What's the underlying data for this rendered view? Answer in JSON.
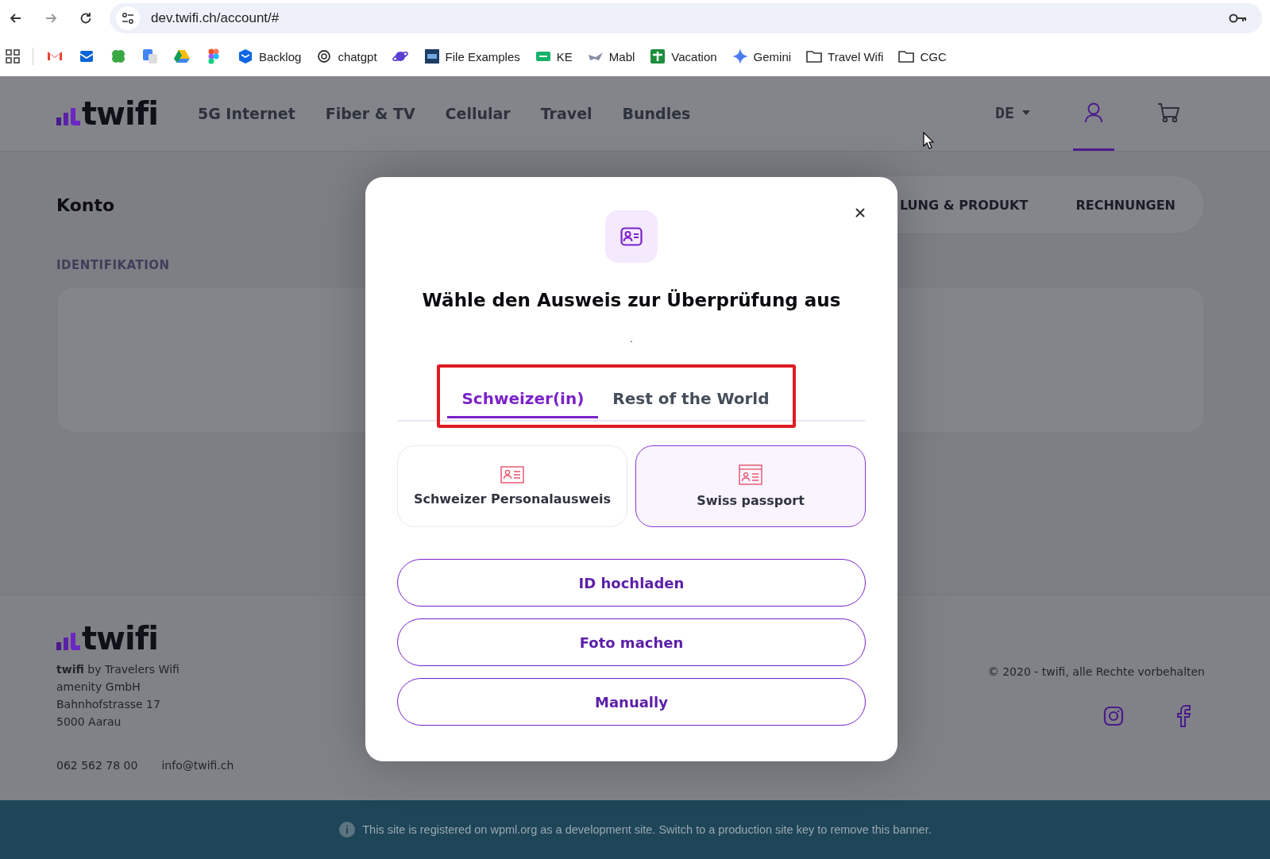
{
  "browser": {
    "url": "dev.twifi.ch/account/#",
    "bookmarks": [
      {
        "kind": "icon_only"
      },
      {
        "kind": "icon_only"
      },
      {
        "kind": "icon_only"
      },
      {
        "kind": "icon_only"
      },
      {
        "kind": "icon_only"
      },
      {
        "kind": "icon_only"
      },
      {
        "kind": "link",
        "label": "Backlog"
      },
      {
        "kind": "link",
        "label": "chatgpt"
      },
      {
        "kind": "icon_only"
      },
      {
        "kind": "link",
        "label": "File Examples"
      },
      {
        "kind": "link",
        "label": "KE"
      },
      {
        "kind": "link",
        "label": "Mabl"
      },
      {
        "kind": "link",
        "label": "Vacation"
      },
      {
        "kind": "link",
        "label": "Gemini"
      },
      {
        "kind": "folder",
        "label": "Travel Wifi"
      },
      {
        "kind": "folder",
        "label": "CGC"
      }
    ]
  },
  "header": {
    "logo": "twifi",
    "nav": [
      "5G Internet",
      "Fiber & TV",
      "Cellular",
      "Travel",
      "Bundles"
    ],
    "actions": [
      {
        "kind": "language",
        "label": "DE",
        "selected": false
      },
      {
        "kind": "account",
        "selected": true
      },
      {
        "kind": "cart",
        "selected": false
      }
    ]
  },
  "account": {
    "title": "Konto",
    "subnav": [
      "LUNG & PRODUKT",
      "RECHNUNGEN"
    ],
    "section": "IDENTIFIKATION"
  },
  "footer": {
    "logo": "twifi",
    "address": [
      "**twifi** by Travelers Wifi",
      "amenity GmbH",
      "Bahnhofstrasse 17",
      "5000 Aarau"
    ],
    "phone": "062 562 78 00",
    "email": "info@twifi.ch",
    "copyright": "© 2020 - twifi, alle Rechte vorbehalten"
  },
  "banner": "This site is registered on wpml.org as a development site. Switch to a production site key to remove this banner.",
  "modal": {
    "title": "Wähle den Ausweis zur Überprüfung aus",
    "subtitle": ".",
    "tabs": [
      {
        "label": "Schweizer(in)",
        "selected": true
      },
      {
        "label": "Rest of the World",
        "selected": false
      }
    ],
    "options": [
      {
        "kind": "id_card",
        "label": "Schweizer Personalausweis",
        "selected": false
      },
      {
        "kind": "passport",
        "label": "Swiss passport",
        "selected": true
      }
    ],
    "actions": [
      "ID hochladen",
      "Foto machen",
      "Manually"
    ]
  }
}
